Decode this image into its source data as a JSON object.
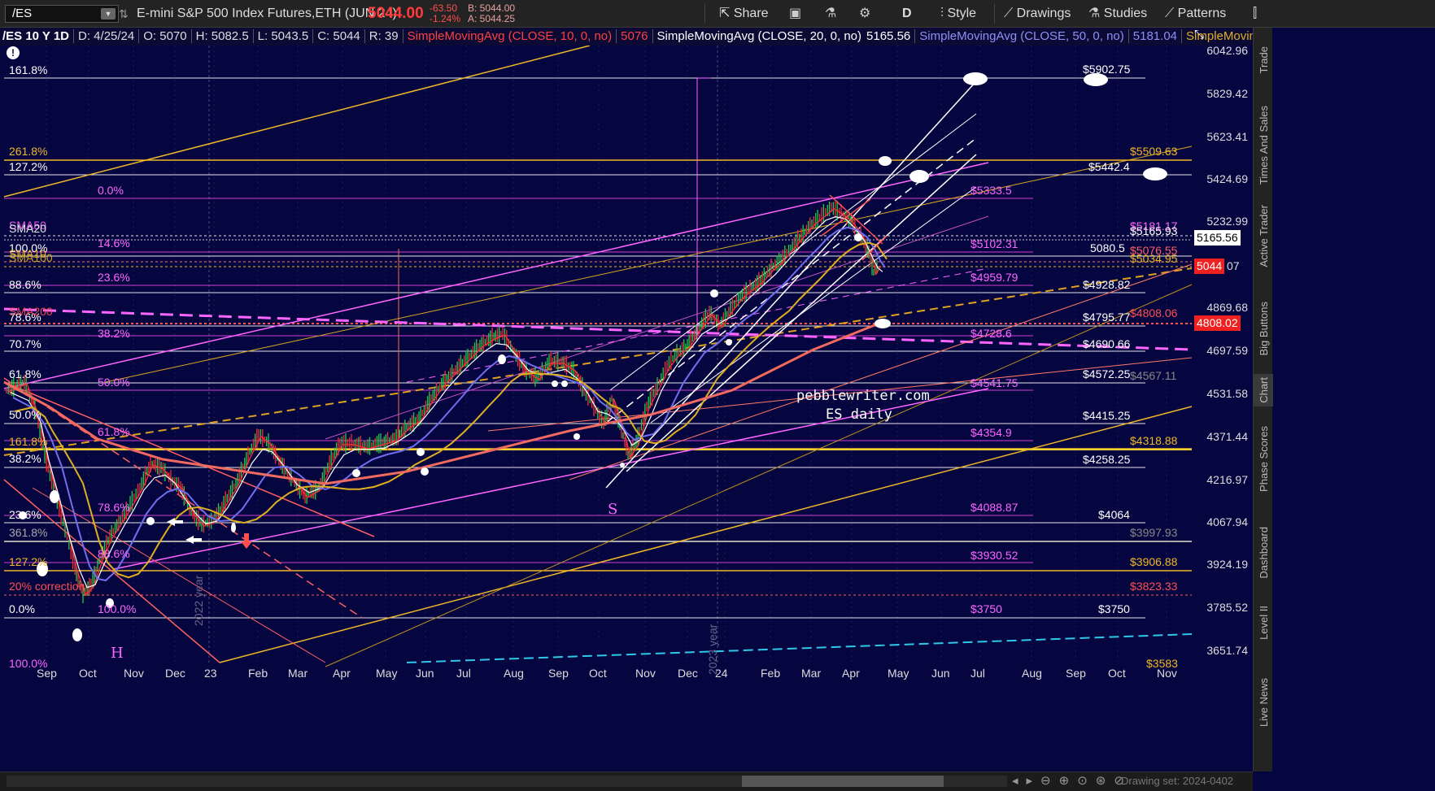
{
  "toolbar": {
    "symbol": "/ES",
    "instrument": "E-mini S&P 500 Index Futures,ETH (JUN 24)",
    "last_price": "5044.00",
    "change": "-63.50",
    "change_pct": "-1.24%",
    "bid": "B: 5044.00",
    "ask": "A: 5044.25",
    "share_label": "Share",
    "period_label": "D",
    "style_label": "Style",
    "drawings_label": "Drawings",
    "studies_label": "Studies",
    "patterns_label": "Patterns"
  },
  "study_bar": {
    "chart_id": "/ES 10 Y 1D",
    "date": "D: 4/25/24",
    "open": "O: 5070",
    "high": "H: 5082.5",
    "low": "L: 5043.5",
    "close": "C: 5044",
    "r": "R: 39",
    "sma10_label": "SimpleMovingAvg (CLOSE, 10, 0, no)",
    "sma10_value": "5076",
    "sma20_label": "SimpleMovingAvg (CLOSE, 20, 0, no)",
    "sma20_value": "5165.56",
    "sma50_label": "SimpleMovingAvg (CLOSE, 50, 0, no)",
    "sma50_value": "5181.04",
    "sma100_label": "SimpleMovingAvg ..."
  },
  "colors": {
    "background": "#050540",
    "red_sma": "#ff4040",
    "white_sma": "#ffffff",
    "blue_sma": "#6f6ff0",
    "yellow_sma": "#e0b020",
    "salmon_sma": "#f06a60",
    "magenta": "#ff66ff",
    "gold": "#f0b828"
  },
  "y_axis": {
    "ticks": [
      "6042.96",
      "5829.42",
      "5623.41",
      "5424.69",
      "5232.99",
      "4869.68",
      "4697.59",
      "4531.58",
      "4371.44",
      "4216.97",
      "4067.94",
      "3924.19",
      "3785.52",
      "3651.74"
    ],
    "current_price_tag": "5044",
    "current_price_tag_suffix": "07",
    "sma20_tag": "5165.56",
    "level_tag": "4808.02"
  },
  "x_axis": {
    "ticks": [
      "Sep",
      "Oct",
      "Nov",
      "Dec",
      "23",
      "Feb",
      "Mar",
      "Apr",
      "May",
      "Jun",
      "Jul",
      "Aug",
      "Sep",
      "Oct",
      "Nov",
      "Dec",
      "24",
      "Feb",
      "Mar",
      "Apr",
      "May",
      "Jun",
      "Jul",
      "Aug",
      "Sep",
      "Oct",
      "Nov"
    ],
    "year_labels": [
      "2022 year",
      "2023 year"
    ]
  },
  "fib_left": [
    "161.8%",
    "261.8%",
    "127.2%",
    "100.0%",
    "88.6%",
    "78.6%",
    "70.7%",
    "61.8%",
    "50.0%",
    "161.8%",
    "38.2%",
    "23.6%",
    "361.8%",
    "127.2%",
    "20% correction",
    "0.0%",
    "100.0%"
  ],
  "fib_left_overlays": [
    "SMA50",
    "SMA20",
    "SMA10",
    "SMA100",
    "SMA200"
  ],
  "fib_mid": [
    "0.0%",
    "14.6%",
    "23.6%",
    "38.2%",
    "50.0%",
    "61.8%",
    "78.6%",
    "88.6%",
    "100.0%"
  ],
  "levels_magenta": [
    "$5333.5",
    "$5102.31",
    "$4959.79",
    "$4728.6",
    "$4541.75",
    "$4354.9",
    "$4088.87",
    "$3930.52",
    "$3750"
  ],
  "levels_white": [
    "$5902.75",
    "$5442.4",
    "5080.5",
    "$4928.82",
    "$4795.77",
    "$4690.66",
    "$4572.25",
    "$4415.25",
    "$4258.25",
    "$4064",
    "$3750"
  ],
  "levels_right": [
    "$5509.63",
    "$5181.17",
    "$5165.93",
    "$5076.55",
    "$5034.95",
    "$4808.06",
    "$4567.11",
    "$4318.88",
    "$3997.93",
    "$3906.88",
    "$3823.33",
    "$3583"
  ],
  "annotations": {
    "watermark_line1": "pebblewriter.com",
    "watermark_line2": "ES daily",
    "h_label": "H",
    "s_label": "S"
  },
  "sidebar_tabs": [
    "Trade",
    "Times And Sales",
    "Active Trader",
    "Big Buttons",
    "Chart",
    "Phase Scores",
    "Dashboard",
    "Level II",
    "Live News"
  ],
  "bottom": {
    "drawing_set": "Drawing set: 2024-0402"
  }
}
